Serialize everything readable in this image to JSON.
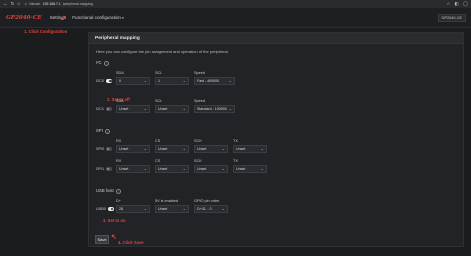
{
  "browser": {
    "nav_icons": [
      "back-icon",
      "reload-icon",
      "home-icon"
    ],
    "warning": "⚠",
    "not_secure": "Niezab.",
    "host": "192.168.7.1",
    "path": "/peripheral-mapping",
    "right_icons": [
      "star-icon",
      "extensions-icon",
      "profile-icon"
    ]
  },
  "app": {
    "logo": "GP2040-CE",
    "menu": {
      "settings": "Settings",
      "functional": "Functional configuration"
    },
    "right_select": "GP2040-CE"
  },
  "annotations": {
    "click_config": "1. Click Configuration",
    "set_off": "2. Set to off",
    "set_on": "3. Set to on",
    "click_save": "4. Click Save"
  },
  "panel": {
    "title": "Peripheral mapping",
    "description": "Here you can configure the pin assignment and operation of the peripheral."
  },
  "i2c": {
    "title": "I²C",
    "rows": [
      {
        "label": "I2C0",
        "enabled": true,
        "sda_label": "SDA",
        "sda": "0",
        "scl_label": "SCL",
        "scl": "1",
        "speed_label": "Speed",
        "speed": "Fast - 400000"
      },
      {
        "label": "I2C1",
        "enabled": false,
        "sda_label": "SDA",
        "sda": "Unset",
        "scl_label": "SCL",
        "scl": "Unset",
        "speed_label": "Speed",
        "speed": "Standard - 100000"
      }
    ]
  },
  "spi": {
    "title": "SPI",
    "rows": [
      {
        "label": "SPI0",
        "rx_label": "RX",
        "rx": "Unset",
        "cs_label": "CS",
        "cs": "Unset",
        "sck_label": "SCK",
        "sck": "Unset",
        "tx_label": "TX",
        "tx": "Unset"
      },
      {
        "label": "SPI1",
        "rx_label": "RX",
        "rx": "Unset",
        "cs_label": "CS",
        "cs": "Unset",
        "sck_label": "SCK",
        "sck": "Unset",
        "tx_label": "TX",
        "tx": "Unset"
      }
    ]
  },
  "usb": {
    "title": "USB host",
    "label": "USB0",
    "enabled": true,
    "dplus_label": "D+",
    "dplus": "28",
    "five_v_label": "5V is enabled",
    "five_v": "Unset",
    "gpio_label": "GPIO pin order",
    "gpio": "D+/D- - 0"
  },
  "save_label": "Save",
  "colors": {
    "accent": "#e0443a",
    "background": "#1b1c1e",
    "panel": "#222326"
  }
}
